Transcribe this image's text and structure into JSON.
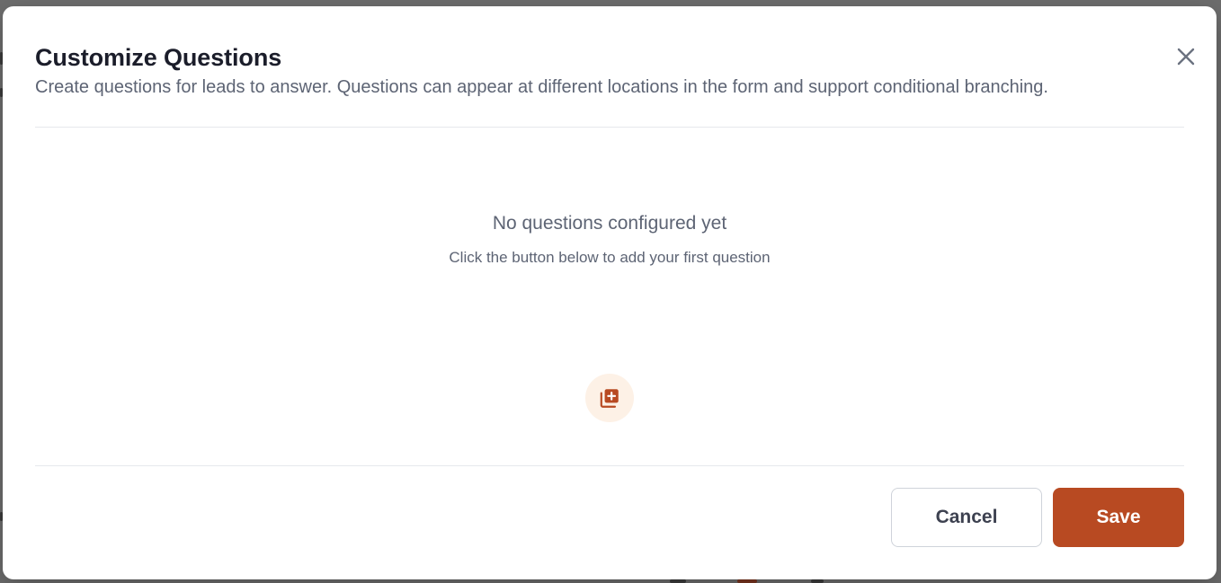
{
  "modal": {
    "title": "Customize Questions",
    "subtitle": "Create questions for leads to answer. Questions can appear at different locations in the form and support conditional branching.",
    "close_icon": "close-icon"
  },
  "empty_state": {
    "title": "No questions configured yet",
    "hint": "Click the button below to add your first question",
    "add_icon": "add-question-icon"
  },
  "footer": {
    "cancel_label": "Cancel",
    "save_label": "Save"
  },
  "colors": {
    "accent": "#b84a22",
    "accent_soft": "#fdf1e6",
    "title": "#1b1d2a",
    "muted": "#5d6474"
  }
}
